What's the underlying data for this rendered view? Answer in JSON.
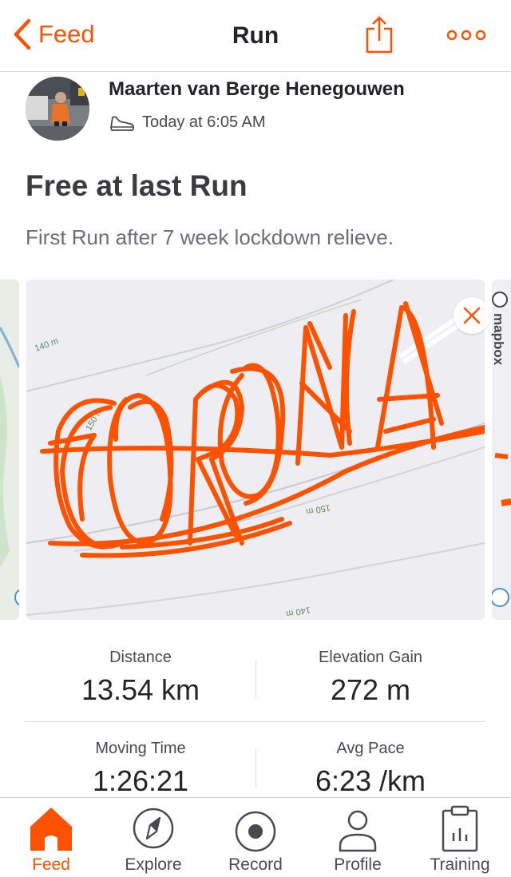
{
  "nav": {
    "back_label": "Feed",
    "title": "Run"
  },
  "colors": {
    "accent": "#fc5200",
    "text": "#242428",
    "route": "#fc5200"
  },
  "activity": {
    "athlete_name": "Maarten van Berge Henegouwen",
    "timestamp": "Today at 6:05 AM",
    "sport_icon": "shoe-icon",
    "title": "Free at last Run",
    "description": "First Run after 7 week lockdown relieve."
  },
  "map": {
    "contour_labels": [
      "140 m",
      "150 m",
      "150 m",
      "140 m"
    ],
    "attribution": "mapbox"
  },
  "stats": [
    {
      "label": "Distance",
      "value": "13.54 km"
    },
    {
      "label": "Elevation Gain",
      "value": "272 m"
    },
    {
      "label": "Moving Time",
      "value": "1:26:21"
    },
    {
      "label": "Avg Pace",
      "value": "6:23 /km"
    }
  ],
  "tabs": [
    {
      "label": "Feed",
      "icon": "home-icon",
      "active": true
    },
    {
      "label": "Explore",
      "icon": "compass-icon",
      "active": false
    },
    {
      "label": "Record",
      "icon": "record-icon",
      "active": false
    },
    {
      "label": "Profile",
      "icon": "profile-icon",
      "active": false
    },
    {
      "label": "Training",
      "icon": "training-icon",
      "active": false
    }
  ]
}
